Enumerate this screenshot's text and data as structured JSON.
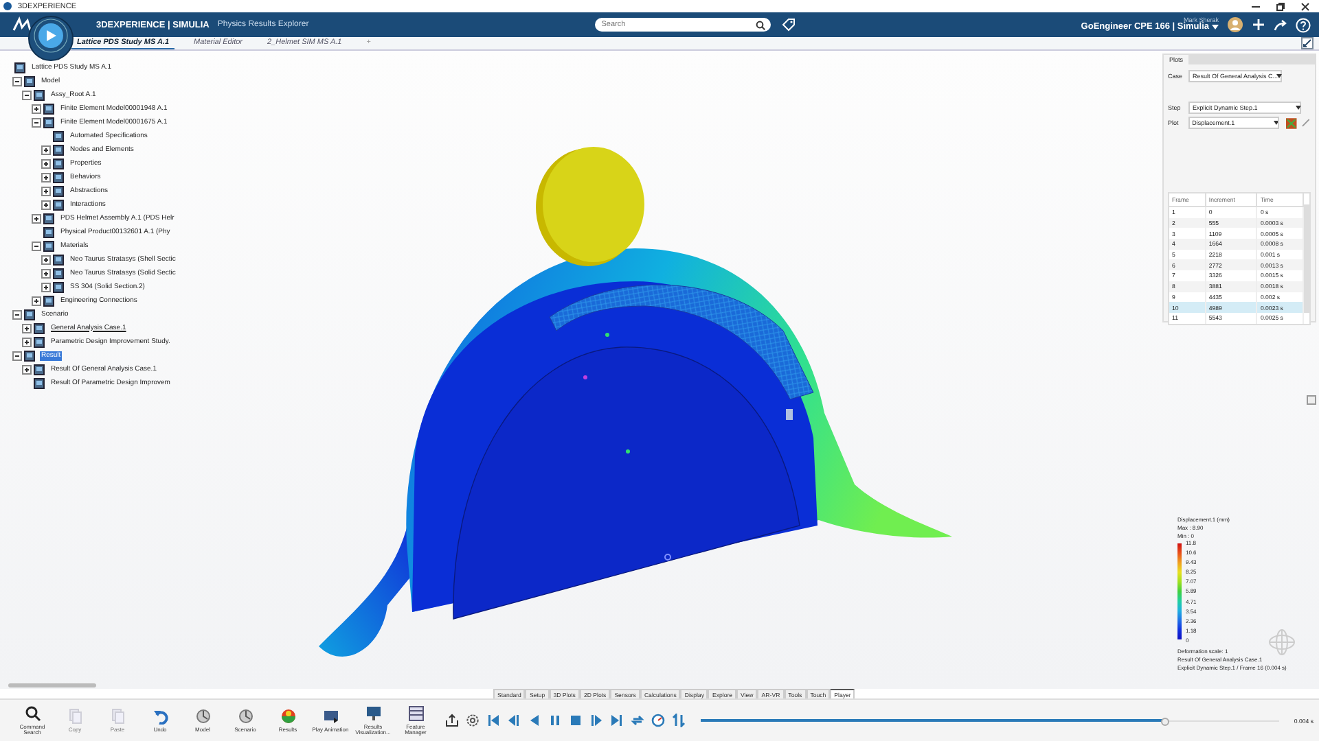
{
  "window": {
    "title": "3DEXPERIENCE"
  },
  "header": {
    "brand": "3DEXPERIENCE | SIMULIA",
    "app": "Physics Results Explorer",
    "search": {
      "placeholder": "Search"
    },
    "user": "Mark Sherak",
    "workspace": "GoEngineer CPE 166 | Simulia"
  },
  "tabs": [
    {
      "label": "Lattice PDS Study MS A.1",
      "selected": true
    },
    {
      "label": "Material Editor",
      "selected": false
    },
    {
      "label": "2_Helmet SIM MS A.1",
      "selected": false
    }
  ],
  "tab_add": "+",
  "tree": [
    {
      "label": "Lattice PDS Study MS A.1",
      "selected": false,
      "current": false,
      "children": [
        {
          "label": "Model",
          "expanded": true,
          "selected": false,
          "current": false,
          "children": [
            {
              "label": "Assy_Root A.1",
              "expanded": true,
              "selected": false,
              "current": false,
              "children": [
                {
                  "label": "Finite Element Model00001948 A.1",
                  "expanded": false,
                  "selected": false,
                  "current": false
                },
                {
                  "label": "Finite Element Model00001675 A.1",
                  "expanded": true,
                  "selected": false,
                  "current": false,
                  "children": [
                    {
                      "label": "Automated Specifications",
                      "selected": false,
                      "current": false
                    },
                    {
                      "label": "Nodes and Elements",
                      "expanded": false,
                      "selected": false,
                      "current": false
                    },
                    {
                      "label": "Properties",
                      "expanded": false,
                      "selected": false,
                      "current": false
                    },
                    {
                      "label": "Behaviors",
                      "expanded": false,
                      "selected": false,
                      "current": false
                    },
                    {
                      "label": "Abstractions",
                      "expanded": false,
                      "selected": false,
                      "current": false
                    },
                    {
                      "label": "Interactions",
                      "expanded": false,
                      "selected": false,
                      "current": false
                    }
                  ]
                },
                {
                  "label": "PDS Helmet Assembly A.1 (PDS Helr",
                  "expanded": false,
                  "selected": false,
                  "current": false
                },
                {
                  "label": "Physical Product00132601 A.1 (Phy",
                  "selected": false,
                  "current": false
                },
                {
                  "label": "Materials",
                  "expanded": true,
                  "selected": false,
                  "current": false,
                  "children": [
                    {
                      "label": "Neo Taurus Stratasys (Shell Sectic",
                      "expanded": false,
                      "selected": false,
                      "current": false
                    },
                    {
                      "label": "Neo Taurus Stratasys (Solid Sectic",
                      "expanded": false,
                      "selected": false,
                      "current": false
                    },
                    {
                      "label": "SS 304 (Solid Section.2)",
                      "expanded": false,
                      "selected": false,
                      "current": false
                    }
                  ]
                },
                {
                  "label": "Engineering Connections",
                  "expanded": false,
                  "selected": false,
                  "current": false
                }
              ]
            }
          ]
        },
        {
          "label": "Scenario",
          "expanded": true,
          "selected": false,
          "current": false,
          "children": [
            {
              "label": "General Analysis Case.1",
              "expanded": false,
              "selected": false,
              "current": true
            },
            {
              "label": "Parametric Design Improvement Study.",
              "expanded": false,
              "selected": false,
              "current": false
            }
          ]
        },
        {
          "label": "Result",
          "expanded": true,
          "selected": true,
          "current": false,
          "children": [
            {
              "label": "Result Of General Analysis Case.1",
              "expanded": false,
              "selected": false,
              "current": false
            },
            {
              "label": "Result Of Parametric Design Improvem",
              "selected": false,
              "current": false
            }
          ]
        }
      ]
    }
  ],
  "plots": {
    "tab": "Plots",
    "case_label": "Case",
    "case": "Result Of General Analysis C...",
    "step_label": "Step",
    "step": "Explicit Dynamic Step.1",
    "plot_label": "Plot",
    "plot": "Displacement.1",
    "columns": [
      "Frame",
      "Increment",
      "Time"
    ],
    "rows": [
      {
        "cells": [
          "1",
          "0",
          "0 s"
        ],
        "selected": false
      },
      {
        "cells": [
          "2",
          "555",
          "0.0003 s"
        ],
        "selected": false
      },
      {
        "cells": [
          "3",
          "1109",
          "0.0005 s"
        ],
        "selected": false
      },
      {
        "cells": [
          "4",
          "1664",
          "0.0008 s"
        ],
        "selected": false
      },
      {
        "cells": [
          "5",
          "2218",
          "0.001 s"
        ],
        "selected": false
      },
      {
        "cells": [
          "6",
          "2772",
          "0.0013 s"
        ],
        "selected": false
      },
      {
        "cells": [
          "7",
          "3326",
          "0.0015 s"
        ],
        "selected": false
      },
      {
        "cells": [
          "8",
          "3881",
          "0.0018 s"
        ],
        "selected": false
      },
      {
        "cells": [
          "9",
          "4435",
          "0.002 s"
        ],
        "selected": false
      },
      {
        "cells": [
          "10",
          "4989",
          "0.0023 s"
        ],
        "selected": true
      },
      {
        "cells": [
          "11",
          "5543",
          "0.0025 s"
        ],
        "selected": false
      }
    ]
  },
  "legend": {
    "title": "Displacement.1 (mm)",
    "max": "Max : 8.90",
    "min": "Min : 0",
    "ticks": [
      "11.8",
      "10.6",
      "9.43",
      "8.25",
      "7.07",
      "5.89",
      "4.71",
      "3.54",
      "2.36",
      "1.18",
      "0"
    ],
    "footer": [
      "Deformation scale: 1",
      "Result Of General Analysis Case.1",
      "Explicit Dynamic Step.1 / Frame 16 (0.004 s)"
    ]
  },
  "toolbar_tabs": [
    {
      "label": "Standard",
      "selected": false
    },
    {
      "label": "Setup",
      "selected": false
    },
    {
      "label": "3D Plots",
      "selected": false
    },
    {
      "label": "2D Plots",
      "selected": false
    },
    {
      "label": "Sensors",
      "selected": false
    },
    {
      "label": "Calculations",
      "selected": false
    },
    {
      "label": "Display",
      "selected": false
    },
    {
      "label": "Explore",
      "selected": false
    },
    {
      "label": "View",
      "selected": false
    },
    {
      "label": "AR-VR",
      "selected": false
    },
    {
      "label": "Tools",
      "selected": false
    },
    {
      "label": "Touch",
      "selected": false
    },
    {
      "label": "Player",
      "selected": true
    }
  ],
  "toolbar": [
    {
      "label": "Command Search",
      "disabled": false
    },
    {
      "label": "Copy",
      "disabled": true
    },
    {
      "label": "Paste",
      "disabled": true
    },
    {
      "label": "Undo",
      "disabled": false
    },
    {
      "label": "Model",
      "disabled": false
    },
    {
      "label": "Scenario",
      "disabled": false
    },
    {
      "label": "Results",
      "disabled": false
    },
    {
      "label": "Play Animation",
      "disabled": false
    },
    {
      "label": "Results Visualization...",
      "disabled": false
    },
    {
      "label": "Feature Manager",
      "disabled": false
    }
  ],
  "player": {
    "level": 0.8,
    "reading": "0.004 s"
  }
}
